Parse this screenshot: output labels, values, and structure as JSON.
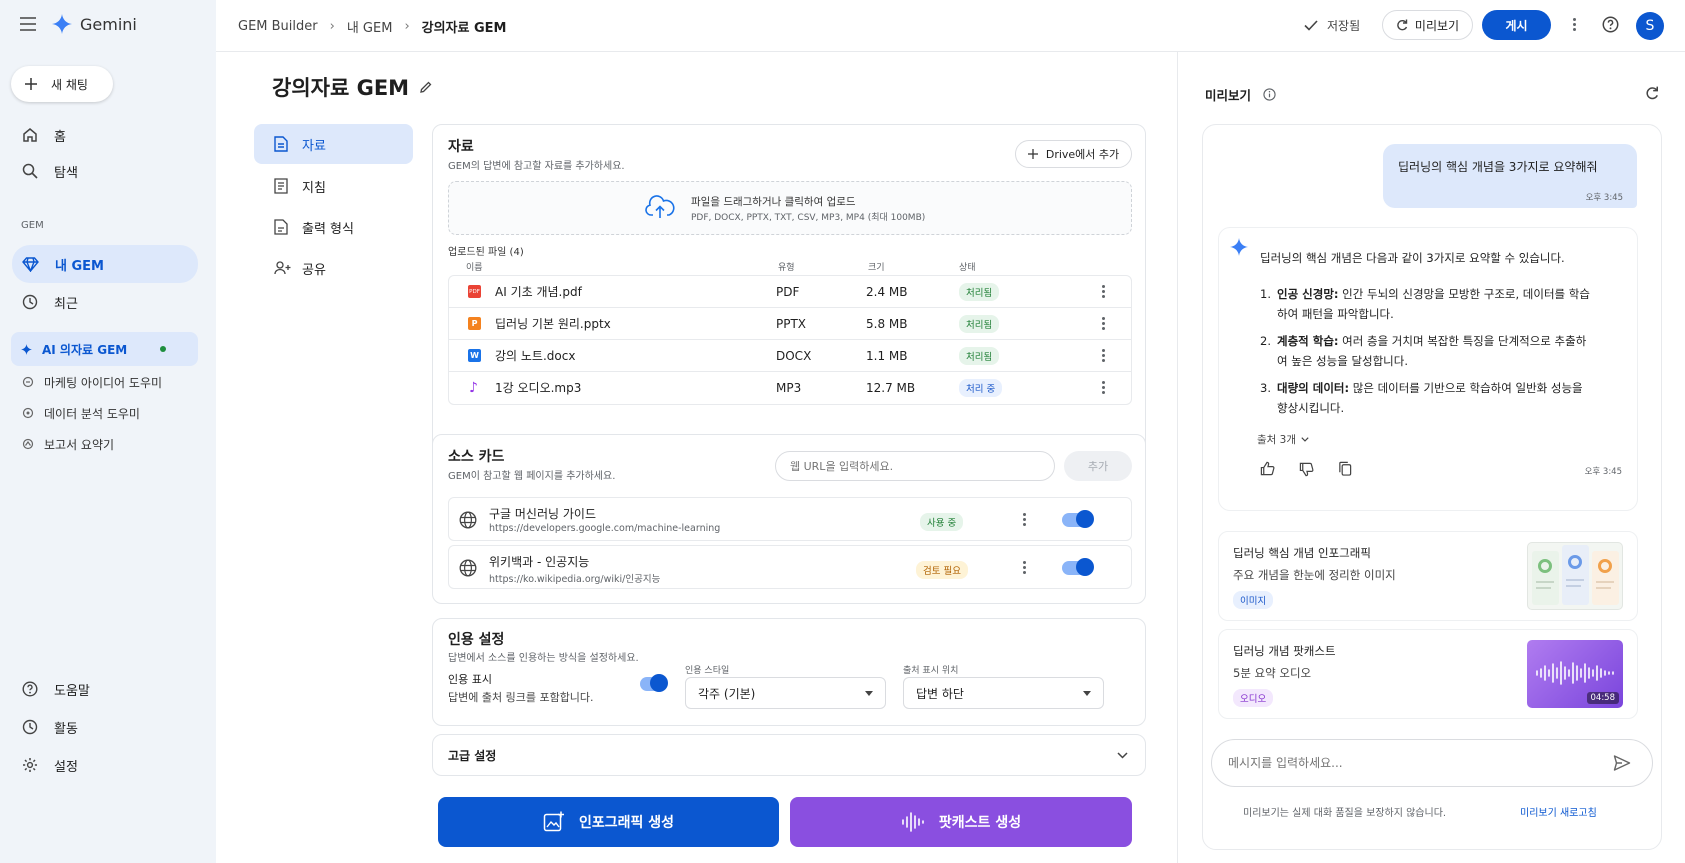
{
  "app": {
    "name": "Gemini"
  },
  "sidebar": {
    "new_chat": "새 채팅",
    "nav": [
      {
        "label": "홈"
      },
      {
        "label": "탐색"
      }
    ],
    "section_gem": "GEM",
    "my_gem": "내 GEM",
    "recent": "최근",
    "gems": [
      {
        "label": "AI 의자료 GEM"
      },
      {
        "label": "마케팅 아이디어 도우미"
      },
      {
        "label": "데이터 분석 도우미"
      },
      {
        "label": "보고서 요약기"
      }
    ],
    "bottom": [
      {
        "label": "도움말"
      },
      {
        "label": "활동"
      },
      {
        "label": "설정"
      }
    ]
  },
  "topbar": {
    "breadcrumb": [
      "GEM Builder",
      "내 GEM",
      "강의자료 GEM"
    ],
    "saved": "저장됨",
    "preview_btn": "미리보기",
    "publish_btn": "게시",
    "avatar": "S"
  },
  "editor": {
    "title": "강의자료 GEM",
    "tabs": [
      {
        "label": "자료"
      },
      {
        "label": "지침"
      },
      {
        "label": "출력 형식"
      },
      {
        "label": "공유"
      }
    ],
    "materials": {
      "title": "자료",
      "subtitle": "GEM의 답변에 참고할 자료를 추가하세요.",
      "drive_btn": "Drive에서 추가",
      "upload_main": "파일을 드래그하거나 클릭하여 업로드",
      "upload_sub": "PDF, DOCX, PPTX, TXT, CSV, MP3, MP4 (최대 100MB)",
      "uploaded_label": "업로드된 파일 (4)",
      "columns": [
        "이름",
        "유형",
        "크기",
        "상태"
      ],
      "files": [
        {
          "name": "AI 기초 개념.pdf",
          "type": "PDF",
          "size": "2.4 MB",
          "status": "처리됨",
          "icon": "pdf-icon",
          "color": "#ea4335"
        },
        {
          "name": "딥러닝 기본 원리.pptx",
          "type": "PPTX",
          "size": "5.8 MB",
          "status": "처리됨",
          "icon": "pptx-icon",
          "color": "#f4821f"
        },
        {
          "name": "강의 노트.docx",
          "type": "DOCX",
          "size": "1.1 MB",
          "status": "처리됨",
          "icon": "docx-icon",
          "color": "#1a73e8"
        },
        {
          "name": "1강 오디오.mp3",
          "type": "MP3",
          "size": "12.7 MB",
          "status": "처리 중",
          "icon": "audio-icon",
          "color": "#9334e6"
        }
      ]
    },
    "sources": {
      "title": "소스 카드",
      "subtitle": "GEM이 참고할 웹 페이지를 추가하세요.",
      "url_placeholder": "웹 URL을 입력하세요.",
      "add_btn": "추가",
      "items": [
        {
          "title": "구글 머신러닝 가이드",
          "url": "https://developers.google.com/machine-learning",
          "status": "사용 중"
        },
        {
          "title": "위키백과 - 인공지능",
          "url": "https://ko.wikipedia.org/wiki/인공지능",
          "status": "검토 필요"
        }
      ]
    },
    "citation": {
      "title": "인용 설정",
      "subtitle": "답변에서 소스를 인용하는 방식을 설정하세요.",
      "toggle_label": "인용 표시",
      "toggle_desc": "답변에 출처 링크를 포함합니다.",
      "style_label": "인용 스타일",
      "style_value": "각주 (기본)",
      "position_label": "출처 표시 위치",
      "position_value": "답변 하단"
    },
    "advanced": "고급 설정",
    "btn_infographic": "인포그래픽 생성",
    "btn_podcast": "팟캐스트 생성"
  },
  "preview": {
    "title": "미리보기",
    "user_msg": "딥러닝의 핵심 개념을 3가지로 요약해줘",
    "user_time": "오후 3:45",
    "answer_intro": "딥러닝의 핵심 개념은 다음과 같이 3가지로 요약할 수 있습니다.",
    "points": [
      {
        "num": "1.",
        "bold": "인공 신경망:",
        "text": " 인간 두뇌의 신경망을 모방한 구조로, 데이터를 학습하여 패턴을 파악합니다."
      },
      {
        "num": "2.",
        "bold": "계층적 학습:",
        "text": " 여러 층을 거치며 복잡한 특징을 단계적으로 추출하여 높은 성능을 달성합니다."
      },
      {
        "num": "3.",
        "bold": "대량의 데이터:",
        "text": " 많은 데이터를 기반으로 학습하여 일반화 성능을 향상시킵니다."
      }
    ],
    "sources_count": "출처 3개",
    "answer_time": "오후 3:45",
    "infographic": {
      "title": "딥러닝 핵심 개념 인포그래픽",
      "desc": "주요 개념을 한눈에 정리한 이미지",
      "tag": "이미지"
    },
    "podcast": {
      "title": "딥러닝 개념 팟캐스트",
      "desc": "5분 요약 오디오",
      "tag": "오디오",
      "duration": "04:58"
    },
    "input_placeholder": "메시지를 입력하세요...",
    "disclaimer": "미리보기는 실제 대화 품질을 보장하지 않습니다.",
    "refresh_link": "미리보기 새로고침"
  },
  "colors": {
    "accent": "#0b57d0",
    "purple": "#8a4fe0",
    "sidebar_bg": "#f0f4f9"
  }
}
